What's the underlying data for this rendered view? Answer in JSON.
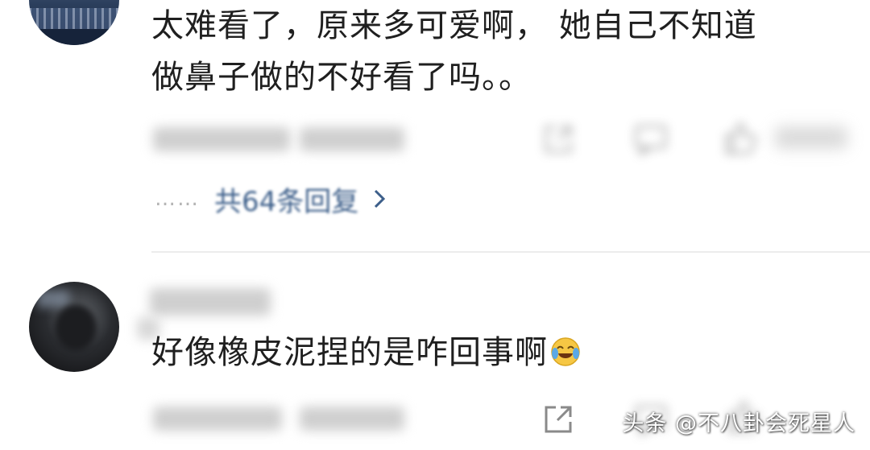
{
  "comments": [
    {
      "text_line1": "太难看了，原来多可爱啊， 她自己不知道",
      "text_line2": "做鼻子做的不好看了吗。。"
    },
    {
      "text": "好像橡皮泥捏的是咋回事啊"
    }
  ],
  "thread": {
    "dots": "……",
    "replies_label": "共64条回复"
  },
  "watermark": "头条 @不八卦会死星人",
  "icons": {
    "share": "share-icon",
    "comment": "comment-icon",
    "like": "like-icon",
    "chevron": "chevron-right-icon",
    "emoji": "laugh-cry-emoji-icon"
  },
  "colors": {
    "link": "#3d5f8a",
    "text": "#1f1f1f",
    "divider": "#ececec"
  }
}
